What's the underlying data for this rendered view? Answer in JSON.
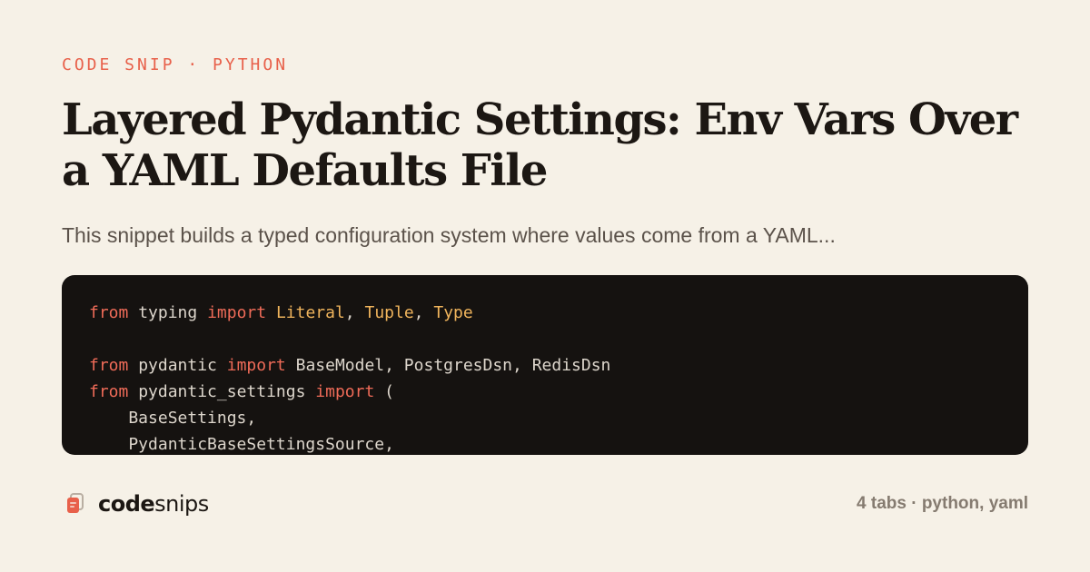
{
  "header": {
    "kicker": "CODE SNIP · PYTHON",
    "title": "Layered Pydantic Settings: Env Vars Over a YAML Defaults File",
    "description": "This snippet builds a typed configuration system where values come from a YAML..."
  },
  "code": {
    "lines": [
      [
        {
          "t": "from",
          "k": "kw"
        },
        {
          "t": " typing ",
          "k": "pl"
        },
        {
          "t": "import",
          "k": "kw"
        },
        {
          "t": " ",
          "k": "pl"
        },
        {
          "t": "Literal",
          "k": "ty"
        },
        {
          "t": ", ",
          "k": "pl"
        },
        {
          "t": "Tuple",
          "k": "ty"
        },
        {
          "t": ", ",
          "k": "pl"
        },
        {
          "t": "Type",
          "k": "ty"
        }
      ],
      [],
      [
        {
          "t": "from",
          "k": "kw"
        },
        {
          "t": " pydantic ",
          "k": "pl"
        },
        {
          "t": "import",
          "k": "kw"
        },
        {
          "t": " BaseModel, PostgresDsn, RedisDsn",
          "k": "pl"
        }
      ],
      [
        {
          "t": "from",
          "k": "kw"
        },
        {
          "t": " pydantic_settings ",
          "k": "pl"
        },
        {
          "t": "import",
          "k": "kw"
        },
        {
          "t": " (",
          "k": "pl"
        }
      ],
      [
        {
          "t": "    BaseSettings,",
          "k": "pl"
        }
      ],
      [
        {
          "t": "    PydanticBaseSettingsSource,",
          "k": "pl"
        }
      ]
    ]
  },
  "footer": {
    "brand_bold": "code",
    "brand_rest": "snips",
    "meta": "4 tabs · python, yaml"
  },
  "colors": {
    "background": "#f6f1e7",
    "accent": "#e8604a",
    "code_bg": "#151210",
    "keyword": "#ef6b58",
    "type": "#f0b45c"
  },
  "icons": {
    "brand": "stacked-pages-icon"
  }
}
